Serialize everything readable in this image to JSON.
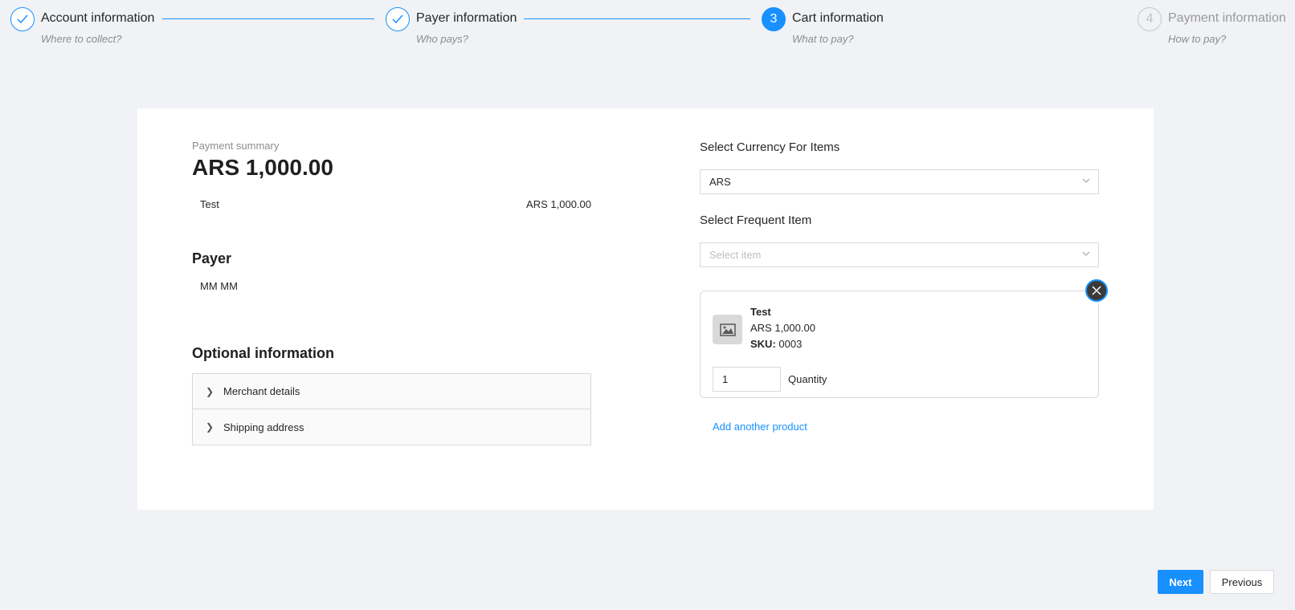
{
  "steps": [
    {
      "title": "Account information",
      "desc": "Where to collect?",
      "status": "finished"
    },
    {
      "title": "Payer information",
      "desc": "Who pays?",
      "status": "finished"
    },
    {
      "number": "3",
      "title": "Cart information",
      "desc": "What to pay?",
      "status": "active"
    },
    {
      "number": "4",
      "title": "Payment information",
      "desc": "How to pay?",
      "status": "waiting"
    }
  ],
  "summary": {
    "label": "Payment summary",
    "total": "ARS 1,000.00",
    "lines": [
      {
        "name": "Test",
        "amount": "ARS 1,000.00"
      }
    ]
  },
  "payer": {
    "heading": "Payer",
    "name": "MM MM"
  },
  "optional": {
    "heading": "Optional information",
    "panels": [
      "Merchant details",
      "Shipping address"
    ]
  },
  "currency": {
    "label": "Select Currency For Items",
    "value": "ARS"
  },
  "frequent_item": {
    "label": "Select Frequent Item",
    "placeholder": "Select item"
  },
  "cart_item": {
    "name": "Test",
    "price": "ARS 1,000.00",
    "sku_label": "SKU:",
    "sku": "0003",
    "quantity": "1",
    "quantity_label": "Quantity"
  },
  "add_product": "Add another product",
  "buttons": {
    "next": "Next",
    "previous": "Previous"
  },
  "colors": {
    "primary": "#1890ff",
    "background": "#f0f2f5"
  }
}
